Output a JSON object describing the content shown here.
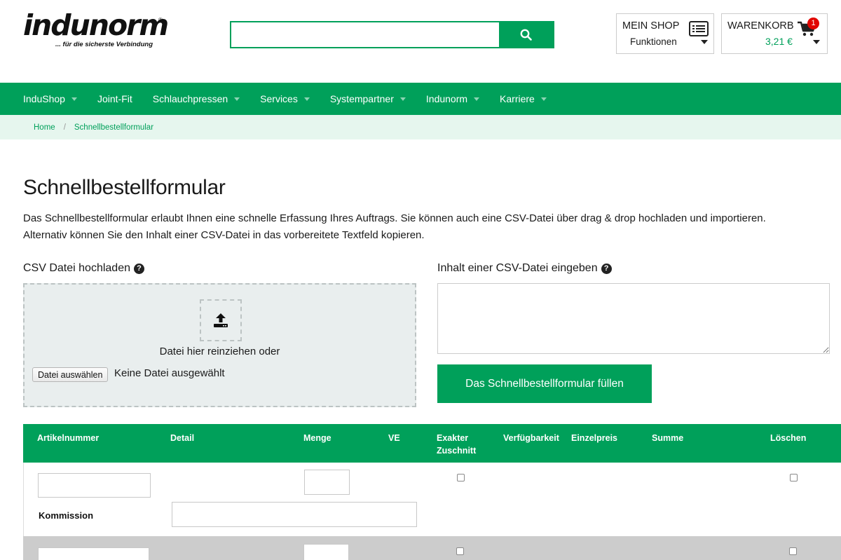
{
  "header": {
    "logo_text": "indunorm",
    "logo_reg": "®",
    "logo_tagline": "... für die sicherste Verbindung",
    "search": {
      "placeholder": "",
      "icon": "search-icon"
    },
    "my_shop": {
      "title": "MEIN SHOP",
      "subtitle": "Funktionen",
      "icon": "list-icon"
    },
    "cart": {
      "title": "WARENKORB",
      "price": "3,21 €",
      "badge": "1",
      "icon": "cart-icon"
    }
  },
  "nav": {
    "items": [
      {
        "label": "InduShop",
        "dropdown": true
      },
      {
        "label": "Joint-Fit",
        "dropdown": false
      },
      {
        "label": "Schlauchpressen",
        "dropdown": true
      },
      {
        "label": "Services",
        "dropdown": true
      },
      {
        "label": "Systempartner",
        "dropdown": true
      },
      {
        "label": "Indunorm",
        "dropdown": true
      },
      {
        "label": "Karriere",
        "dropdown": true
      }
    ]
  },
  "breadcrumb": {
    "home": "Home",
    "separator": "/",
    "current": "Schnellbestellformular"
  },
  "main": {
    "title": "Schnellbestellformular",
    "intro": "Das Schnellbestellformular erlaubt Ihnen eine schnelle Erfassung Ihres Auftrags. Sie können auch eine CSV-Datei über drag & drop hochladen und importieren. Alternativ können Sie den Inhalt einer CSV-Datei in das vorbereitete Textfeld kopieren.",
    "upload": {
      "label": "CSV Datei hochladen",
      "drop_text": "Datei hier reinziehen oder",
      "file_button": "Datei auswählen",
      "no_file": "Keine Datei ausgewählt"
    },
    "csv_input": {
      "label": "Inhalt einer CSV-Datei eingeben",
      "placeholder": "",
      "fill_button": "Das Schnellbestellformular füllen"
    }
  },
  "table": {
    "headers": {
      "article": "Artikelnummer",
      "detail": "Detail",
      "quantity": "Menge",
      "ve": "VE",
      "exact_cut_1": "Exakter",
      "exact_cut_2": "Zuschnitt",
      "availability": "Verfügbarkeit",
      "unit_price": "Einzelpreis",
      "sum": "Summe",
      "delete": "Löschen"
    },
    "commission_label": "Kommission"
  },
  "colors": {
    "brand_green": "#00a05a",
    "breadcrumb_bg": "#e6f6ee",
    "badge_red": "#e10600"
  }
}
